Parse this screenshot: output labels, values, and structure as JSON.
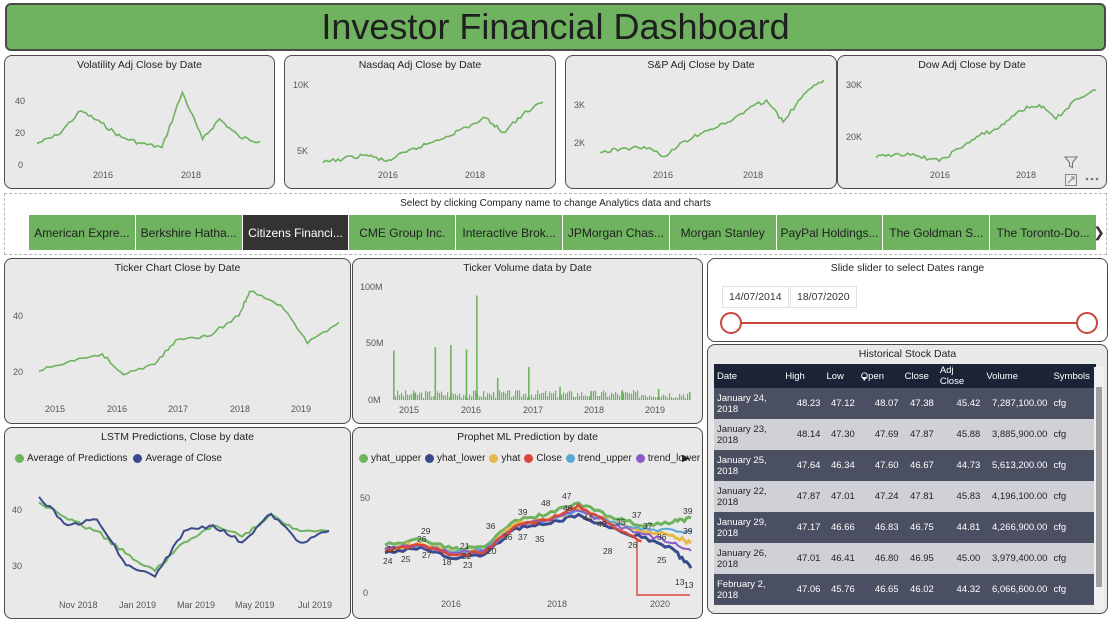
{
  "header": {
    "title": "Investor Financial Dashboard"
  },
  "colors": {
    "accent": "#6fb25f",
    "selected_tile": "#333333",
    "slider": "#c8483d",
    "table_header": "#1b2437"
  },
  "top_charts": [
    {
      "title": "Volatility Adj Close by Date",
      "yticks": [
        "40",
        "20",
        "0"
      ],
      "xticks": [
        "2016",
        "2018"
      ]
    },
    {
      "title": "Nasdaq Adj Close by Date",
      "yticks": [
        "10K",
        "5K"
      ],
      "xticks": [
        "2016",
        "2018"
      ]
    },
    {
      "title": "S&P Adj Close by Date",
      "yticks": [
        "3K",
        "2K"
      ],
      "xticks": [
        "2016",
        "2018"
      ]
    },
    {
      "title": "Dow Adj Close by Date",
      "yticks": [
        "30K",
        "20K"
      ],
      "xticks": [
        "2016",
        "2018"
      ]
    }
  ],
  "visual_icons": {
    "filter": "filter-icon",
    "focus": "focus-mode-icon",
    "more": "more-options-icon"
  },
  "slicer": {
    "title": "Select by clicking Company name to change Analytics data and charts",
    "companies": [
      "American Expre...",
      "Berkshire Hatha...",
      "Citizens Financi...",
      "CME Group Inc.",
      "Interactive Brok...",
      "JPMorgan Chas...",
      "Morgan Stanley",
      "PayPal Holdings...",
      "The Goldman S...",
      "The Toronto-Do..."
    ],
    "selected_index": 2,
    "next_icon": "chevron-right-icon",
    "next_glyph": "❯"
  },
  "ticker_chart": {
    "title": "Ticker Chart Close by Date",
    "yticks": [
      "40",
      "20"
    ],
    "xticks": [
      "2015",
      "2016",
      "2017",
      "2018",
      "2019"
    ]
  },
  "volume_chart": {
    "title": "Ticker Volume data by Date",
    "yticks": [
      "100M",
      "50M",
      "0M"
    ],
    "xticks": [
      "2015",
      "2016",
      "2017",
      "2018",
      "2019"
    ]
  },
  "date_slider": {
    "title": "Slide slider to select Dates range",
    "start": "14/07/2014",
    "end": "18/07/2020",
    "start_fraction": 0,
    "end_fraction": 1
  },
  "lstm_chart": {
    "title": "LSTM Predictions, Close by date",
    "legend": [
      {
        "label": "Average of Predictions",
        "color": "#6fb25f"
      },
      {
        "label": "Average of Close",
        "color": "#3b4a8c"
      }
    ],
    "yticks": [
      "40",
      "30"
    ],
    "xticks": [
      "Nov 2018",
      "Jan 2019",
      "Mar 2019",
      "May 2019",
      "Jul 2019"
    ]
  },
  "prophet_chart": {
    "title": "Prophet ML Prediction by date",
    "legend": [
      {
        "label": "yhat_upper",
        "color": "#6fb25f"
      },
      {
        "label": "yhat_lower",
        "color": "#3b4a8c"
      },
      {
        "label": "yhat",
        "color": "#e8b84a"
      },
      {
        "label": "Close",
        "color": "#d9483b"
      },
      {
        "label": "trend_upper",
        "color": "#5ba6d8"
      },
      {
        "label": "trend_lower",
        "color": "#8e5cc7"
      }
    ],
    "legend_more_glyph": "▶",
    "yticks": [
      "50",
      "0"
    ],
    "xticks": [
      "2016",
      "2018",
      "2020"
    ],
    "point_labels": [
      "22",
      "24",
      "25",
      "27",
      "29",
      "26",
      "21",
      "18",
      "22",
      "23",
      "20",
      "36",
      "36",
      "37",
      "35",
      "39",
      "48",
      "47",
      "46",
      "44",
      "40",
      "35",
      "28",
      "37",
      "37",
      "39",
      "39",
      "36",
      "26",
      "25",
      "13",
      "13"
    ]
  },
  "table": {
    "title": "Historical Stock Data",
    "columns": [
      "Date",
      "High",
      "Low",
      "Open",
      "Close",
      "Adj Close",
      "Volume",
      "Symbols"
    ],
    "sort_glyph": "▼",
    "rows": [
      [
        "January 24, 2018",
        "48.23",
        "47.12",
        "48.07",
        "47.38",
        "45.42",
        "7,287,100.00",
        "cfg"
      ],
      [
        "January 23, 2018",
        "48.14",
        "47.30",
        "47.69",
        "47.87",
        "45.88",
        "3,885,900.00",
        "cfg"
      ],
      [
        "January 25, 2018",
        "47.64",
        "46.34",
        "47.60",
        "46.67",
        "44.73",
        "5,613,200.00",
        "cfg"
      ],
      [
        "January 22, 2018",
        "47.87",
        "47.01",
        "47.24",
        "47.81",
        "45.83",
        "4,196,100.00",
        "cfg"
      ],
      [
        "January 29, 2018",
        "47.17",
        "46.66",
        "46.83",
        "46.75",
        "44.81",
        "4,266,900.00",
        "cfg"
      ],
      [
        "January 26, 2018",
        "47.01",
        "46.41",
        "46.80",
        "46.95",
        "45.00",
        "3,979,400.00",
        "cfg"
      ],
      [
        "February 2, 2018",
        "47.06",
        "45.76",
        "46.65",
        "46.02",
        "44.32",
        "6,066,600.00",
        "cfg"
      ]
    ]
  },
  "chart_data": [
    {
      "type": "line",
      "title": "Volatility Adj Close by Date",
      "ylim": [
        0,
        45
      ],
      "x": [
        "2014-07",
        "2015-01",
        "2015-08",
        "2016-02",
        "2016-08",
        "2017-02",
        "2017-08",
        "2018-02",
        "2018-08",
        "2019-01",
        "2019-07",
        "2020-01"
      ],
      "series": [
        {
          "values": [
            12,
            16,
            28,
            22,
            15,
            12,
            10,
            37,
            14,
            24,
            15,
            13
          ]
        }
      ]
    },
    {
      "type": "line",
      "title": "Nasdaq Adj Close by Date",
      "ylim": [
        4000,
        11000
      ],
      "x": [
        "2014-07",
        "2015-01",
        "2015-08",
        "2016-02",
        "2016-08",
        "2017-02",
        "2017-08",
        "2018-02",
        "2018-08",
        "2019-01",
        "2019-07",
        "2020-01"
      ],
      "series": [
        {
          "values": [
            4400,
            4700,
            5000,
            4500,
            5200,
            5800,
            6400,
            7100,
            7800,
            6700,
            8100,
            9000
          ]
        }
      ]
    },
    {
      "type": "line",
      "title": "S&P Adj Close by Date",
      "ylim": [
        1700,
        3300
      ],
      "x": [
        "2014-07",
        "2015-01",
        "2015-08",
        "2016-02",
        "2016-08",
        "2017-02",
        "2017-08",
        "2018-02",
        "2018-08",
        "2019-01",
        "2019-07",
        "2020-01"
      ],
      "series": [
        {
          "values": [
            1970,
            2030,
            2070,
            1900,
            2170,
            2350,
            2470,
            2700,
            2880,
            2500,
            2980,
            3230
          ]
        }
      ]
    },
    {
      "type": "line",
      "title": "Dow Adj Close by Date",
      "ylim": [
        15000,
        31000
      ],
      "x": [
        "2014-07",
        "2015-01",
        "2015-08",
        "2016-02",
        "2016-08",
        "2017-02",
        "2017-08",
        "2018-02",
        "2018-08",
        "2019-01",
        "2019-07",
        "2020-01"
      ],
      "series": [
        {
          "values": [
            16800,
            17500,
            17000,
            16200,
            18400,
            20600,
            22000,
            25000,
            26000,
            23500,
            27000,
            28500
          ]
        }
      ]
    },
    {
      "type": "line",
      "title": "Ticker Chart Close by Date",
      "ylim": [
        14,
        48
      ],
      "x": [
        "2014-10",
        "2015-04",
        "2015-10",
        "2016-02",
        "2016-08",
        "2016-12",
        "2017-06",
        "2017-12",
        "2018-02",
        "2018-08",
        "2019-01",
        "2019-07"
      ],
      "series": [
        {
          "values": [
            22,
            25,
            27,
            21,
            24,
            31,
            32,
            38,
            45,
            41,
            30,
            36
          ]
        }
      ]
    },
    {
      "type": "bar",
      "title": "Ticker Volume data by Date",
      "ylim": [
        0,
        110000000
      ],
      "categories": [
        "2014-10",
        "2015-02",
        "2015-06",
        "2015-09",
        "2015-12",
        "2016-02",
        "2016-06",
        "2016-12",
        "2017-06",
        "2017-12",
        "2018-06",
        "2019-01",
        "2019-07"
      ],
      "values": [
        45000000,
        6000000,
        48000000,
        50000000,
        46000000,
        95000000,
        20000000,
        30000000,
        12000000,
        8000000,
        9000000,
        10000000,
        7000000
      ]
    },
    {
      "type": "line",
      "title": "LSTM Predictions, Close by date",
      "ylim": [
        25,
        45
      ],
      "x": [
        "2018-09",
        "2018-10",
        "2018-11",
        "2018-12",
        "2019-01",
        "2019-02",
        "2019-03",
        "2019-04",
        "2019-05",
        "2019-06",
        "2019-07"
      ],
      "series": [
        {
          "name": "Average of Predictions",
          "values": [
            40,
            37,
            35,
            31,
            28,
            33,
            36,
            34,
            38,
            35,
            35
          ]
        },
        {
          "name": "Average of Close",
          "values": [
            41,
            36,
            37,
            29,
            27,
            35,
            36,
            33,
            38,
            33,
            35
          ]
        }
      ]
    },
    {
      "type": "line",
      "title": "Prophet ML Prediction by date",
      "ylim": [
        0,
        60
      ],
      "x": [
        "2014-10",
        "2015-06",
        "2016-01",
        "2016-08",
        "2017-03",
        "2017-10",
        "2018-05",
        "2018-12",
        "2019-07",
        "2020-02",
        "2020-06"
      ],
      "series": [
        {
          "name": "yhat_upper",
          "values": [
            25,
            28,
            23,
            24,
            38,
            41,
            47,
            40,
            35,
            37,
            39
          ]
        },
        {
          "name": "yhat_lower",
          "values": [
            21,
            24,
            18,
            20,
            34,
            36,
            41,
            34,
            29,
            23,
            13
          ]
        },
        {
          "name": "yhat",
          "values": [
            23,
            26,
            21,
            22,
            36,
            38,
            44,
            37,
            32,
            30,
            26
          ]
        },
        {
          "name": "Close",
          "values": [
            22,
            25,
            20,
            21,
            35,
            38,
            46,
            36,
            27
          ]
        },
        {
          "name": "trend_upper",
          "values": [
            23,
            25,
            21,
            22,
            35,
            38,
            43,
            37,
            33,
            33,
            32
          ]
        },
        {
          "name": "trend_lower",
          "values": [
            23,
            25,
            21,
            22,
            35,
            38,
            43,
            36,
            31,
            26,
            22
          ]
        }
      ]
    }
  ]
}
